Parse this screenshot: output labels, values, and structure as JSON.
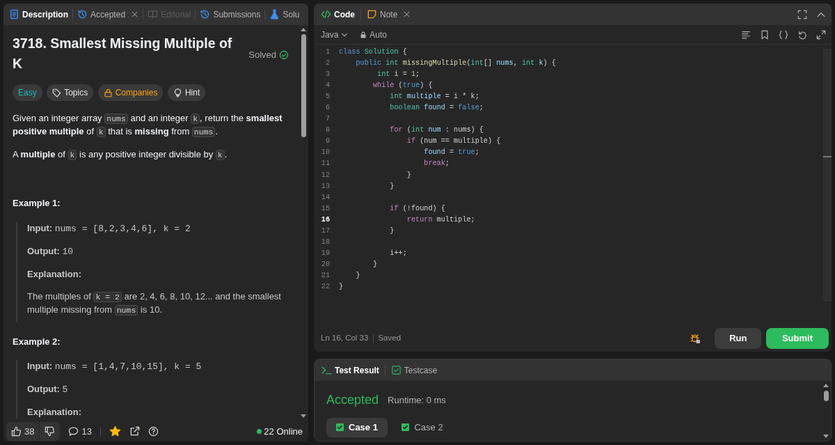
{
  "problem_panel": {
    "tabs": [
      {
        "label": "Description",
        "selected": true,
        "disabled": false,
        "closable": false
      },
      {
        "label": "Accepted",
        "selected": false,
        "disabled": false,
        "closable": true
      },
      {
        "label": "Editorial",
        "selected": false,
        "disabled": true,
        "closable": false
      },
      {
        "label": "Submissions",
        "selected": false,
        "disabled": false,
        "closable": false
      },
      {
        "label": "Solu",
        "selected": false,
        "disabled": false,
        "closable": false
      }
    ],
    "title": "3718. Smallest Missing Multiple of K",
    "status": "Solved",
    "tags": [
      {
        "label": "Easy",
        "kind": "difficulty"
      },
      {
        "label": "Topics",
        "kind": "topics"
      },
      {
        "label": "Companies",
        "kind": "companies"
      },
      {
        "label": "Hint",
        "kind": "hint"
      }
    ],
    "description": [
      [
        {
          "kind": "text",
          "text": "Given an integer array "
        },
        {
          "kind": "code",
          "text": "nums"
        },
        {
          "kind": "text",
          "text": " and an integer "
        },
        {
          "kind": "code",
          "text": "k"
        },
        {
          "kind": "text",
          "text": ", return the **smallest positive multiple** of "
        },
        {
          "kind": "code",
          "text": "k"
        },
        {
          "kind": "text",
          "text": " that is **missing** from "
        },
        {
          "kind": "code",
          "text": "nums"
        },
        {
          "kind": "text",
          "text": "."
        }
      ],
      [
        {
          "kind": "text",
          "text": "A **multiple** of "
        },
        {
          "kind": "code",
          "text": "k"
        },
        {
          "kind": "text",
          "text": " is any positive integer divisible by "
        },
        {
          "kind": "code",
          "text": "k"
        },
        {
          "kind": "text",
          "text": "."
        }
      ]
    ],
    "examples": [
      {
        "title": "Example 1:",
        "input_label": "Input:",
        "input": "nums = [8,2,3,4,6], k = 2",
        "output_label": "Output:",
        "output": "10",
        "explanation_label": "Explanation:",
        "explanation": [
          {
            "kind": "text",
            "text": "The multiples of "
          },
          {
            "kind": "code",
            "text": "k = 2"
          },
          {
            "kind": "text",
            "text": " are 2, 4, 6, 8, 10, 12... and the smallest multiple missing from "
          },
          {
            "kind": "code",
            "text": "nums"
          },
          {
            "kind": "text",
            "text": " is 10."
          }
        ]
      },
      {
        "title": "Example 2:",
        "input_label": "Input:",
        "input": "nums = [1,4,7,10,15], k = 5",
        "output_label": "Output:",
        "output": "5",
        "explanation_label": "Explanation:"
      }
    ],
    "footer": {
      "likes": "38",
      "comments": "13",
      "favorited": true,
      "online": "22 Online"
    }
  },
  "editor": {
    "tabs": [
      {
        "label": "Code",
        "selected": true,
        "closable": false
      },
      {
        "label": "Note",
        "selected": false,
        "closable": true
      }
    ],
    "language": "Java",
    "mode": "Auto",
    "lines": [
      {
        "number": "1",
        "active": false,
        "tokens": [
          {
            "text": "class",
            "kind": "kw"
          },
          {
            "text": " Solution",
            "kind": "type"
          },
          {
            "text": " {",
            "kind": "p"
          }
        ]
      },
      {
        "number": "2",
        "active": false,
        "tokens": [
          {
            "text": "    public",
            "kind": "kw"
          },
          {
            "text": " int",
            "kind": "type"
          },
          {
            "text": " missingMultiple",
            "kind": "fn"
          },
          {
            "text": "(",
            "kind": "p"
          },
          {
            "text": "int",
            "kind": "type"
          },
          {
            "text": "[] ",
            "kind": "p"
          },
          {
            "text": "nums",
            "kind": "var"
          },
          {
            "text": ", ",
            "kind": "p"
          },
          {
            "text": "int",
            "kind": "type"
          },
          {
            "text": " k",
            "kind": "var"
          },
          {
            "text": ") {",
            "kind": "p"
          }
        ]
      },
      {
        "number": "3",
        "active": false,
        "tokens": [
          {
            "text": "         int",
            "kind": "type"
          },
          {
            "text": " i = ",
            "kind": "p"
          },
          {
            "text": "1",
            "kind": "num"
          },
          {
            "text": ";",
            "kind": "p"
          }
        ]
      },
      {
        "number": "4",
        "active": false,
        "tokens": [
          {
            "text": "        while",
            "kind": "ctrl"
          },
          {
            "text": " (",
            "kind": "p"
          },
          {
            "text": "true",
            "kind": "kw"
          },
          {
            "text": ") {",
            "kind": "p"
          }
        ]
      },
      {
        "number": "5",
        "active": false,
        "tokens": [
          {
            "text": "            int",
            "kind": "type"
          },
          {
            "text": " multiple",
            "kind": "var"
          },
          {
            "text": " = i * k;",
            "kind": "p"
          }
        ]
      },
      {
        "number": "6",
        "active": false,
        "tokens": [
          {
            "text": "            boolean",
            "kind": "type"
          },
          {
            "text": " found",
            "kind": "var"
          },
          {
            "text": " = ",
            "kind": "p"
          },
          {
            "text": "false",
            "kind": "kw"
          },
          {
            "text": ";",
            "kind": "p"
          }
        ]
      },
      {
        "number": "7",
        "active": false
      },
      {
        "number": "8",
        "active": false,
        "tokens": [
          {
            "text": "            for",
            "kind": "ctrl"
          },
          {
            "text": " (",
            "kind": "p"
          },
          {
            "text": "int",
            "kind": "type"
          },
          {
            "text": " num",
            "kind": "var"
          },
          {
            "text": " : nums) {",
            "kind": "p"
          }
        ]
      },
      {
        "number": "9",
        "active": false,
        "tokens": [
          {
            "text": "                if",
            "kind": "ctrl"
          },
          {
            "text": " (num == multiple) {",
            "kind": "p"
          }
        ]
      },
      {
        "number": "10",
        "active": false,
        "tokens": [
          {
            "text": "                    found",
            "kind": "var"
          },
          {
            "text": " = ",
            "kind": "p"
          },
          {
            "text": "true",
            "kind": "kw"
          },
          {
            "text": ";",
            "kind": "p"
          }
        ]
      },
      {
        "number": "11",
        "active": false,
        "tokens": [
          {
            "text": "                    break",
            "kind": "ctrl"
          },
          {
            "text": ";",
            "kind": "p"
          }
        ]
      },
      {
        "number": "12",
        "active": false,
        "tokens": [
          {
            "text": "                }",
            "kind": "p"
          }
        ]
      },
      {
        "number": "13",
        "active": false,
        "tokens": [
          {
            "text": "            }",
            "kind": "p"
          }
        ]
      },
      {
        "number": "14",
        "active": false
      },
      {
        "number": "15",
        "active": false,
        "tokens": [
          {
            "text": "            if",
            "kind": "ctrl"
          },
          {
            "text": " (!found) {",
            "kind": "p"
          }
        ]
      },
      {
        "number": "16",
        "active": true,
        "tokens": [
          {
            "text": "                return",
            "kind": "ctrl"
          },
          {
            "text": " multiple;",
            "kind": "p"
          }
        ]
      },
      {
        "number": "17",
        "active": false,
        "tokens": [
          {
            "text": "            }",
            "kind": "p"
          }
        ]
      },
      {
        "number": "18",
        "active": false
      },
      {
        "number": "19",
        "active": false,
        "tokens": [
          {
            "text": "            i++;",
            "kind": "p"
          }
        ]
      },
      {
        "number": "20",
        "active": false,
        "tokens": [
          {
            "text": "        }",
            "kind": "p"
          }
        ]
      },
      {
        "number": "21",
        "active": false,
        "tokens": [
          {
            "text": "    }",
            "kind": "p"
          }
        ]
      },
      {
        "number": "22",
        "active": false,
        "tokens": [
          {
            "text": "}",
            "kind": "p"
          }
        ]
      }
    ],
    "cursor": "Ln 16, Col 33",
    "save_state": "Saved",
    "run": "Run",
    "submit": "Submit"
  },
  "console": {
    "tabs": [
      {
        "label": "Test Result",
        "selected": true
      },
      {
        "label": "Testcase",
        "selected": false
      }
    ],
    "verdict": "Accepted",
    "runtime": "Runtime: 0 ms",
    "cases": [
      {
        "label": "Case 1",
        "selected": true,
        "passed": true
      },
      {
        "label": "Case 2",
        "selected": false,
        "passed": true
      }
    ]
  }
}
